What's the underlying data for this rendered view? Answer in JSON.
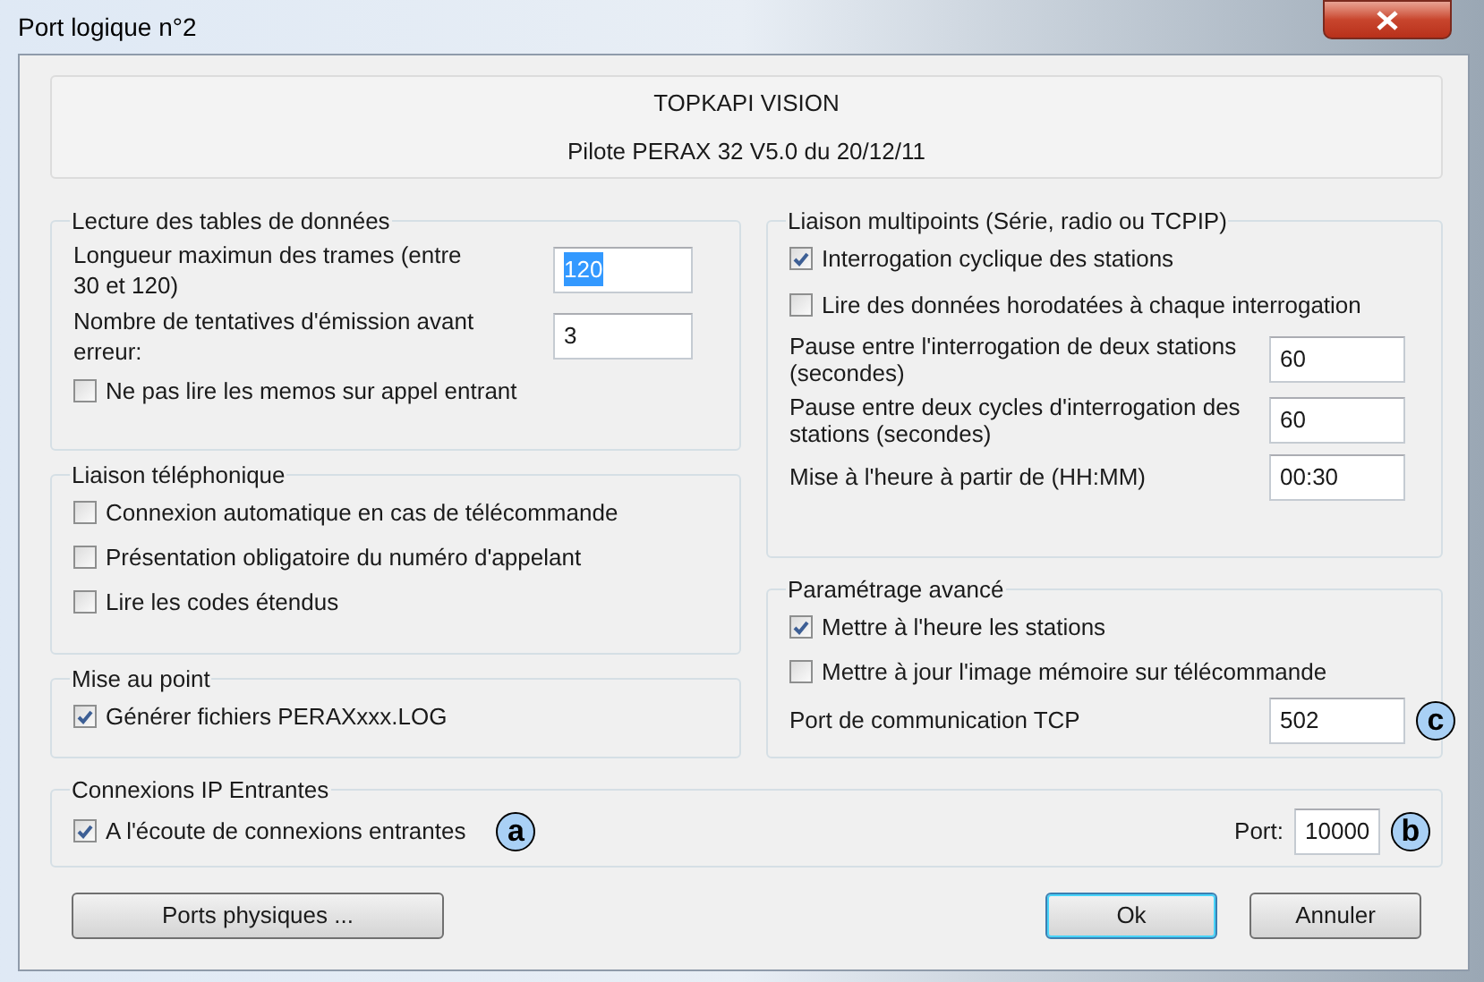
{
  "window": {
    "title": "Port logique n°2"
  },
  "header": {
    "lines": [
      "TOPKAPI VISION",
      "Pilote PERAX 32 V5.0 du 20/12/11"
    ]
  },
  "left_groups": [
    {
      "title": "Lecture des tables de données",
      "items": [
        {
          "kind": "field",
          "label": "Longueur maximun des trames (entre 30 et 120)",
          "value": "120",
          "text_selected": true
        },
        {
          "kind": "field",
          "label": "Nombre de tentatives d'émission avant erreur:",
          "value": "3",
          "text_selected": false
        },
        {
          "kind": "checkbox",
          "label": "Ne pas lire les memos sur appel entrant",
          "checked": false
        }
      ]
    },
    {
      "title": "Liaison téléphonique",
      "items": [
        {
          "kind": "checkbox",
          "label": "Connexion automatique en cas de télécommande",
          "checked": false
        },
        {
          "kind": "checkbox",
          "label": "Présentation obligatoire du numéro d'appelant",
          "checked": false
        },
        {
          "kind": "checkbox",
          "label": "Lire les codes étendus",
          "checked": false
        }
      ]
    },
    {
      "title": "Mise au point",
      "items": [
        {
          "kind": "checkbox",
          "label": "Générer fichiers PERAXxxx.LOG",
          "checked": true
        }
      ]
    }
  ],
  "right_groups": [
    {
      "title": "Liaison multipoints (Série, radio ou TCPIP)",
      "items": [
        {
          "kind": "checkbox",
          "label": "Interrogation cyclique des stations",
          "checked": true
        },
        {
          "kind": "checkbox",
          "label": "Lire des données horodatées à chaque interrogation",
          "checked": false
        },
        {
          "kind": "field",
          "label": "Pause entre l'interrogation de deux stations (secondes)",
          "value": "60",
          "text_selected": false
        },
        {
          "kind": "field",
          "label": "Pause entre deux cycles d'interrogation des stations (secondes)",
          "value": "60",
          "text_selected": false
        },
        {
          "kind": "field",
          "label": "Mise à l'heure à partir de (HH:MM)",
          "value": "00:30",
          "text_selected": false
        }
      ]
    },
    {
      "title": "Paramétrage avancé",
      "items": [
        {
          "kind": "checkbox",
          "label": "Mettre à l'heure les stations",
          "checked": true
        },
        {
          "kind": "checkbox",
          "label": "Mettre à jour l'image mémoire sur télécommande",
          "checked": false
        },
        {
          "kind": "field",
          "label": "Port de communication TCP",
          "value": "502",
          "text_selected": false,
          "callout": "c"
        }
      ]
    }
  ],
  "ip_group": {
    "title": "Connexions IP Entrantes",
    "checkbox": {
      "label": "A l'écoute de connexions entrantes",
      "checked": true,
      "callout": "a"
    },
    "port": {
      "label": "Port:",
      "value": "10000",
      "callout": "b"
    }
  },
  "buttons": [
    {
      "label": "Ports physiques ...",
      "default": false
    },
    {
      "label": "Ok",
      "default": true
    },
    {
      "label": "Annuler",
      "default": false
    }
  ]
}
